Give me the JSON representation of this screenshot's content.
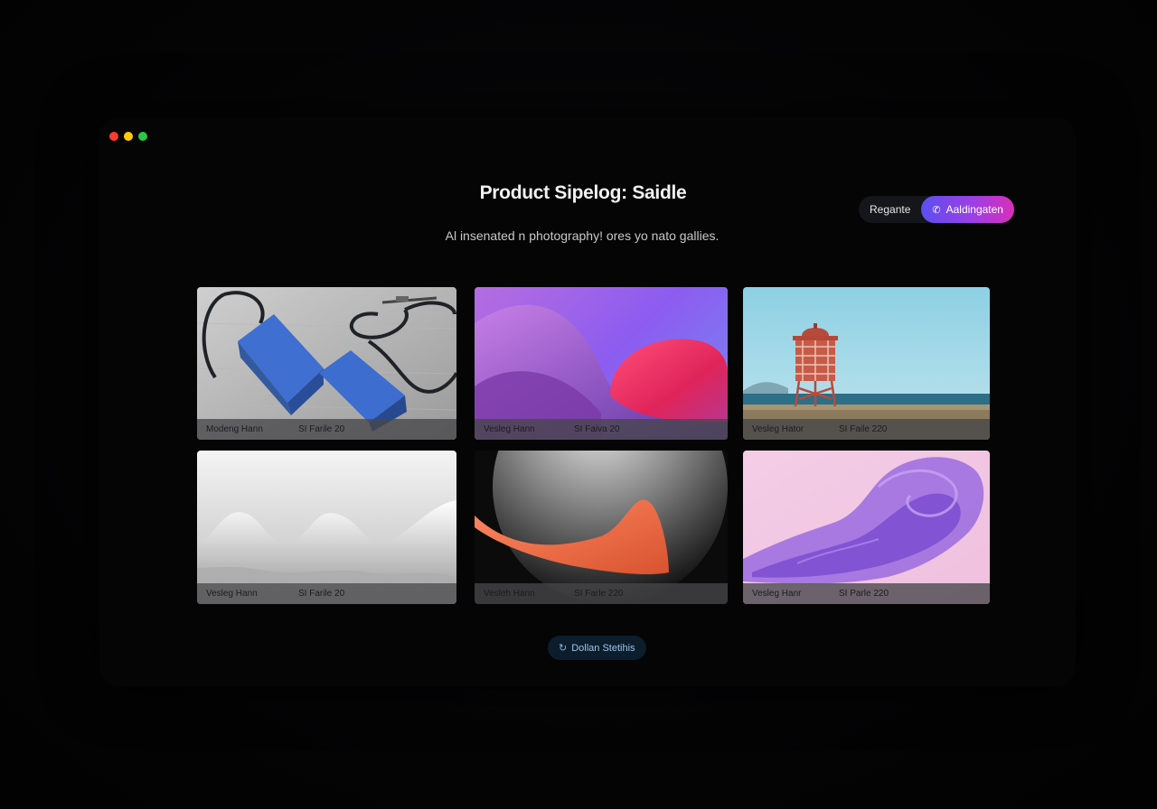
{
  "window": {
    "controls": [
      "close",
      "minimize",
      "maximize"
    ]
  },
  "header": {
    "title": "Product Sipelog: Saidle",
    "subtitle": "Al insenated n photography! ores yo nato gallies."
  },
  "actions": {
    "secondary_label": "Regante",
    "primary_label": "Aaldingaten",
    "primary_icon": "phone-icon"
  },
  "gallery": {
    "items": [
      {
        "name": "Modeng Hann",
        "meta": "SI Farile 20",
        "art": "blue-blocks-cables"
      },
      {
        "name": "Vesleg Hann",
        "meta": "SI Faiva 20",
        "art": "purple-abstract-waves"
      },
      {
        "name": "Vesleg Hator",
        "meta": "SI Faile 220",
        "art": "red-lighthouse-beach"
      },
      {
        "name": "Vesleg Hann",
        "meta": "SI Farile 20",
        "art": "white-wave-sculpture"
      },
      {
        "name": "Vesleh Hann",
        "meta": "SI Farle 220",
        "art": "orange-shape-dark-sphere"
      },
      {
        "name": "Vesleg Hanr",
        "meta": "SI Parle 220",
        "art": "violet-smoke-pink"
      }
    ]
  },
  "footer": {
    "button_label": "Dollan Stetihis",
    "button_icon": "refresh-icon"
  },
  "colors": {
    "background": "#030303",
    "accent_start": "#5b4ff0",
    "accent_end": "#d92fb8",
    "footer_button_bg": "#0c1d2c"
  }
}
